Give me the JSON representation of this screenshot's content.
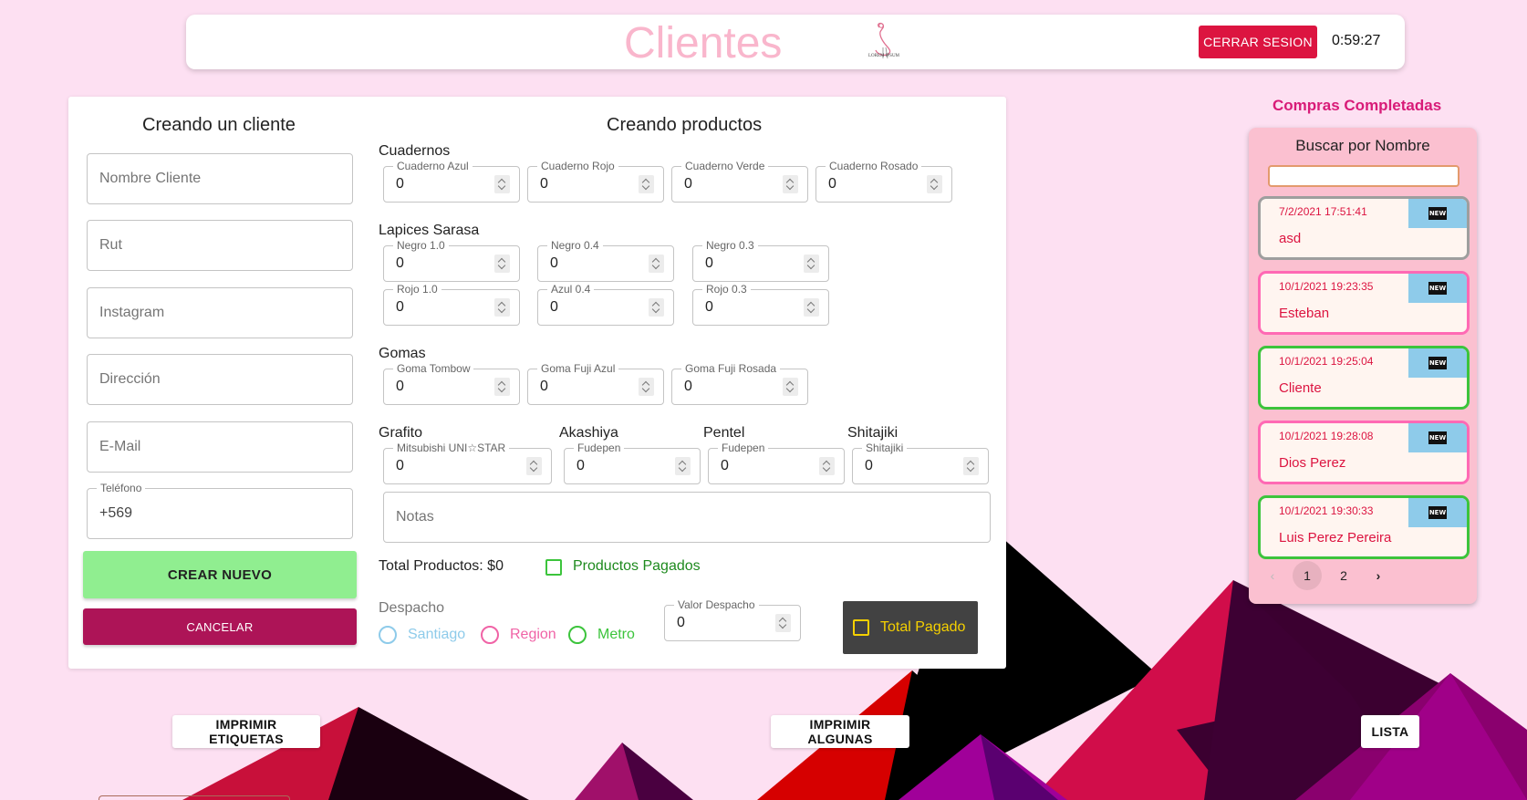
{
  "header": {
    "title": "Clientes",
    "logo_text": "LOREM IPSUM",
    "logout_label": "CERRAR SESION",
    "clock": "0:59:27"
  },
  "client_form": {
    "title": "Creando un cliente",
    "fields": [
      {
        "placeholder": "Nombre Cliente"
      },
      {
        "placeholder": "Rut"
      },
      {
        "placeholder": "Instagram"
      },
      {
        "placeholder": "Dirección"
      },
      {
        "placeholder": "E-Mail"
      }
    ],
    "phone": {
      "label": "Teléfono",
      "value": "+569"
    },
    "create_label": "CREAR NUEVO",
    "cancel_label": "CANCELAR"
  },
  "products": {
    "title": "Creando productos",
    "cuadernos": {
      "label": "Cuadernos",
      "items": [
        {
          "label": "Cuaderno Azul",
          "value": "0"
        },
        {
          "label": "Cuaderno Rojo",
          "value": "0"
        },
        {
          "label": "Cuaderno Verde",
          "value": "0"
        },
        {
          "label": "Cuaderno Rosado",
          "value": "0"
        }
      ]
    },
    "lapices": {
      "label": "Lapices Sarasa",
      "items": [
        {
          "label": "Negro 1.0",
          "value": "0"
        },
        {
          "label": "Negro 0.4",
          "value": "0"
        },
        {
          "label": "Negro 0.3",
          "value": "0"
        },
        {
          "label": "Rojo 1.0",
          "value": "0"
        },
        {
          "label": "Azul 0.4",
          "value": "0"
        },
        {
          "label": "Rojo 0.3",
          "value": "0"
        }
      ]
    },
    "gomas": {
      "label": "Gomas",
      "items": [
        {
          "label": "Goma Tombow",
          "value": "0"
        },
        {
          "label": "Goma Fuji Azul",
          "value": "0"
        },
        {
          "label": "Goma Fuji Rosada",
          "value": "0"
        }
      ]
    },
    "misc": [
      {
        "group": "Grafito",
        "label": "Mitsubishi UNI☆STAR",
        "value": "0"
      },
      {
        "group": "Akashiya",
        "label": "Fudepen",
        "value": "0"
      },
      {
        "group": "Pentel",
        "label": "Fudepen",
        "value": "0"
      },
      {
        "group": "Shitajiki",
        "label": "Shitajiki",
        "value": "0"
      }
    ],
    "notes_placeholder": "Notas",
    "total_products": "Total Productos: $0",
    "paid_label": "Productos Pagados",
    "dispatch": {
      "label": "Despacho",
      "options": [
        "Santiago",
        "Region",
        "Metro"
      ],
      "value_label": "Valor Despacho",
      "value": "0"
    },
    "total_paid_label": "Total Pagado"
  },
  "side": {
    "title": "Compras Completadas",
    "search_label": "Buscar por Nombre",
    "orders": [
      {
        "date": "7/2/2021 17:51:41",
        "name": "asd",
        "badge": "NEW"
      },
      {
        "date": "10/1/2021 19:23:35",
        "name": "Esteban",
        "badge": "NEW"
      },
      {
        "date": "10/1/2021 19:25:04",
        "name": "Cliente",
        "badge": "NEW"
      },
      {
        "date": "10/1/2021 19:28:08",
        "name": "Dios Perez",
        "badge": "NEW"
      },
      {
        "date": "10/1/2021 19:30:33",
        "name": "Luis Perez Pereira",
        "badge": "NEW"
      }
    ],
    "pages": [
      "1",
      "2"
    ]
  },
  "bottom_buttons": {
    "print_labels": "IMPRIMIR ETIQUETAS",
    "print_some": "IMPRIMIR ALGUNAS",
    "list": "LISTA"
  },
  "colors": {
    "background": "#fde0f2",
    "accent": "#dc1440",
    "create": "#90ee90",
    "cancel": "#ad1457",
    "order_border_pink": "#ff69b4",
    "order_border_green": "#3cc43c",
    "order_border_gray": "#9e9e9e"
  }
}
